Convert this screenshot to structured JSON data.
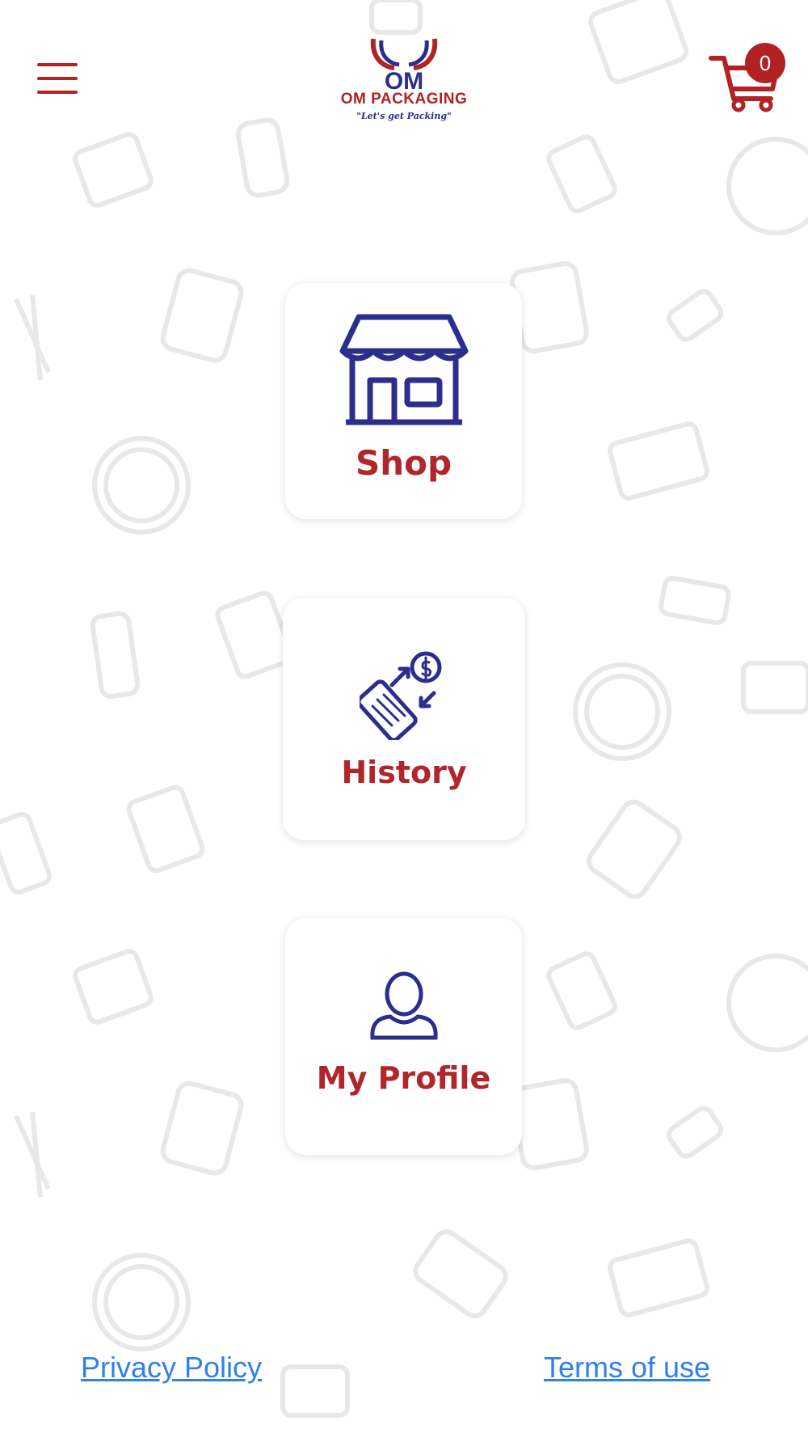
{
  "header": {
    "menu_icon": "hamburger-icon",
    "logo_title": "OM PACKAGING",
    "logo_tagline": "\"Let's get Packing\"",
    "cart_icon": "cart-icon",
    "cart_count": "0"
  },
  "tiles": [
    {
      "label": "Shop",
      "icon": "storefront-icon"
    },
    {
      "label": "History",
      "icon": "transaction-history-icon"
    },
    {
      "label": "My Profile",
      "icon": "user-profile-icon"
    }
  ],
  "footer": {
    "privacy_label": "Privacy Policy",
    "terms_label": "Terms of use"
  },
  "colors": {
    "brand_red": "#b22222",
    "brand_navy": "#2b2e8c",
    "link_blue": "#2f80ed",
    "background_pattern": "#e6e6e6"
  }
}
